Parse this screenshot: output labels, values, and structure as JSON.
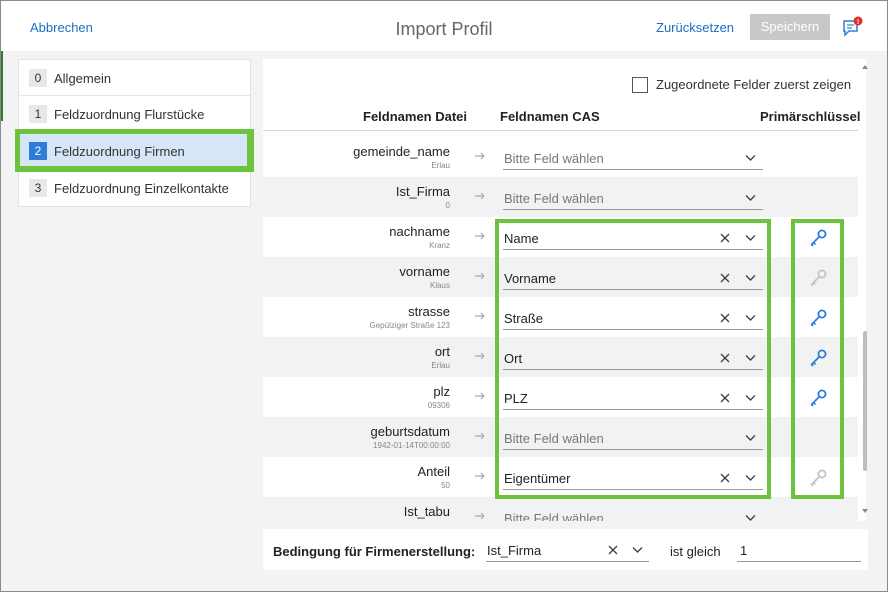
{
  "header": {
    "cancel_label": "Abbrechen",
    "title": "Import Profil",
    "reset_label": "Zurücksetzen",
    "save_label": "Speichern",
    "notification_badge": "!"
  },
  "sidebar": {
    "items": [
      {
        "num": "0",
        "label": "Allgemein",
        "active": false
      },
      {
        "num": "1",
        "label": "Feldzuordnung Flurstücke",
        "active": false
      },
      {
        "num": "2",
        "label": "Feldzuordnung Firmen",
        "active": true
      },
      {
        "num": "3",
        "label": "Feldzuordnung Einzelkontakte",
        "active": false
      }
    ]
  },
  "main": {
    "checkbox_label": "Zugeordnete Felder zuerst zeigen",
    "checkbox_checked": false,
    "columns": {
      "file": "Feldnamen Datei",
      "cas": "Feldnamen CAS",
      "pk": "Primärschlüssel"
    },
    "rows": [
      {
        "field": "gemeinde_name",
        "sample": "Erlau",
        "value": "Bitte Feld wählen",
        "placeholder": true,
        "pk": "none"
      },
      {
        "field": "Ist_Firma",
        "sample": "0",
        "value": "Bitte Feld wählen",
        "placeholder": true,
        "pk": "none"
      },
      {
        "field": "nachname",
        "sample": "Kranz",
        "value": "Name",
        "placeholder": false,
        "pk": "active"
      },
      {
        "field": "vorname",
        "sample": "Klaus",
        "value": "Vorname",
        "placeholder": false,
        "pk": "inactive"
      },
      {
        "field": "strasse",
        "sample": "Gepülziger Straße 123",
        "value": "Straße",
        "placeholder": false,
        "pk": "active"
      },
      {
        "field": "ort",
        "sample": "Erlau",
        "value": "Ort",
        "placeholder": false,
        "pk": "active"
      },
      {
        "field": "plz",
        "sample": "09306",
        "value": "PLZ",
        "placeholder": false,
        "pk": "active"
      },
      {
        "field": "geburtsdatum",
        "sample": "1942-01-14T00:00:00",
        "value": "Bitte Feld wählen",
        "placeholder": true,
        "pk": "none"
      },
      {
        "field": "Anteil",
        "sample": "50",
        "value": "Eigentümer",
        "placeholder": false,
        "pk": "inactive"
      },
      {
        "field": "Ist_tabu",
        "sample": "",
        "value": "Bitte Feld wählen",
        "placeholder": true,
        "pk": "none"
      }
    ]
  },
  "footer": {
    "condition_label": "Bedingung für Firmenerstellung:",
    "condition_field": "Ist_Firma",
    "operator": "ist gleich",
    "condition_value": "1"
  },
  "colors": {
    "accent": "#1c6dc7",
    "key_active": "#2d7fd6",
    "key_inactive": "#c4c4c4",
    "highlight": "#6dc33b",
    "sidebar_active_bg": "#d6e6f8"
  }
}
